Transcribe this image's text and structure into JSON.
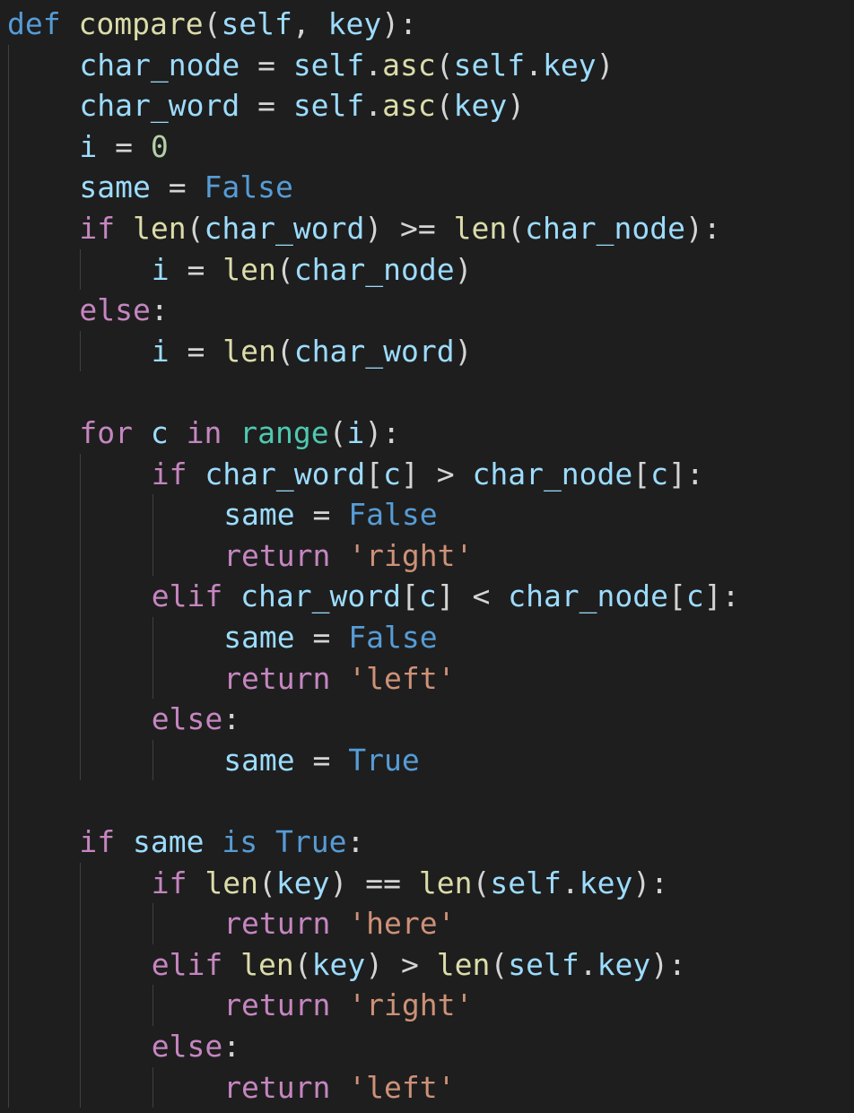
{
  "editor": {
    "language": "python",
    "background": "#1e1e1e",
    "colors": {
      "kw-blue": "#569cd6",
      "kw-ctrl": "#c586c0",
      "fn": "#dcdcaa",
      "cls": "#4ec9b0",
      "var": "#9cdcfe",
      "num": "#b5cea8",
      "str": "#ce9178",
      "op": "#d4d4d4"
    },
    "lines": [
      {
        "indent": 0,
        "tokens": [
          [
            "kw-blue",
            "def"
          ],
          [
            "op",
            " "
          ],
          [
            "fn",
            "compare"
          ],
          [
            "op",
            "("
          ],
          [
            "var",
            "self"
          ],
          [
            "op",
            ", "
          ],
          [
            "var",
            "key"
          ],
          [
            "op",
            "):"
          ]
        ]
      },
      {
        "indent": 1,
        "tokens": [
          [
            "var",
            "char_node"
          ],
          [
            "op",
            " = "
          ],
          [
            "var",
            "self"
          ],
          [
            "op",
            "."
          ],
          [
            "fn",
            "asc"
          ],
          [
            "op",
            "("
          ],
          [
            "var",
            "self"
          ],
          [
            "op",
            "."
          ],
          [
            "var",
            "key"
          ],
          [
            "op",
            ")"
          ]
        ]
      },
      {
        "indent": 1,
        "tokens": [
          [
            "var",
            "char_word"
          ],
          [
            "op",
            " = "
          ],
          [
            "var",
            "self"
          ],
          [
            "op",
            "."
          ],
          [
            "fn",
            "asc"
          ],
          [
            "op",
            "("
          ],
          [
            "var",
            "key"
          ],
          [
            "op",
            ")"
          ]
        ]
      },
      {
        "indent": 1,
        "tokens": [
          [
            "var",
            "i"
          ],
          [
            "op",
            " = "
          ],
          [
            "num",
            "0"
          ]
        ]
      },
      {
        "indent": 1,
        "tokens": [
          [
            "var",
            "same"
          ],
          [
            "op",
            " = "
          ],
          [
            "kw-blue",
            "False"
          ]
        ]
      },
      {
        "indent": 1,
        "tokens": [
          [
            "kw-ctrl",
            "if"
          ],
          [
            "op",
            " "
          ],
          [
            "fn",
            "len"
          ],
          [
            "op",
            "("
          ],
          [
            "var",
            "char_word"
          ],
          [
            "op",
            ") >= "
          ],
          [
            "fn",
            "len"
          ],
          [
            "op",
            "("
          ],
          [
            "var",
            "char_node"
          ],
          [
            "op",
            "):"
          ]
        ]
      },
      {
        "indent": 2,
        "tokens": [
          [
            "var",
            "i"
          ],
          [
            "op",
            " = "
          ],
          [
            "fn",
            "len"
          ],
          [
            "op",
            "("
          ],
          [
            "var",
            "char_node"
          ],
          [
            "op",
            ")"
          ]
        ]
      },
      {
        "indent": 1,
        "tokens": [
          [
            "kw-ctrl",
            "else"
          ],
          [
            "op",
            ":"
          ]
        ]
      },
      {
        "indent": 2,
        "tokens": [
          [
            "var",
            "i"
          ],
          [
            "op",
            " = "
          ],
          [
            "fn",
            "len"
          ],
          [
            "op",
            "("
          ],
          [
            "var",
            "char_word"
          ],
          [
            "op",
            ")"
          ]
        ]
      },
      {
        "indent": 0,
        "tokens": []
      },
      {
        "indent": 1,
        "tokens": [
          [
            "kw-ctrl",
            "for"
          ],
          [
            "op",
            " "
          ],
          [
            "var",
            "c"
          ],
          [
            "op",
            " "
          ],
          [
            "kw-ctrl",
            "in"
          ],
          [
            "op",
            " "
          ],
          [
            "cls",
            "range"
          ],
          [
            "op",
            "("
          ],
          [
            "var",
            "i"
          ],
          [
            "op",
            "):"
          ]
        ]
      },
      {
        "indent": 2,
        "tokens": [
          [
            "kw-ctrl",
            "if"
          ],
          [
            "op",
            " "
          ],
          [
            "var",
            "char_word"
          ],
          [
            "op",
            "["
          ],
          [
            "var",
            "c"
          ],
          [
            "op",
            "] > "
          ],
          [
            "var",
            "char_node"
          ],
          [
            "op",
            "["
          ],
          [
            "var",
            "c"
          ],
          [
            "op",
            "]:"
          ]
        ]
      },
      {
        "indent": 3,
        "tokens": [
          [
            "var",
            "same"
          ],
          [
            "op",
            " = "
          ],
          [
            "kw-blue",
            "False"
          ]
        ]
      },
      {
        "indent": 3,
        "tokens": [
          [
            "kw-ctrl",
            "return"
          ],
          [
            "op",
            " "
          ],
          [
            "str",
            "'right'"
          ]
        ]
      },
      {
        "indent": 2,
        "tokens": [
          [
            "kw-ctrl",
            "elif"
          ],
          [
            "op",
            " "
          ],
          [
            "var",
            "char_word"
          ],
          [
            "op",
            "["
          ],
          [
            "var",
            "c"
          ],
          [
            "op",
            "] < "
          ],
          [
            "var",
            "char_node"
          ],
          [
            "op",
            "["
          ],
          [
            "var",
            "c"
          ],
          [
            "op",
            "]:"
          ]
        ]
      },
      {
        "indent": 3,
        "tokens": [
          [
            "var",
            "same"
          ],
          [
            "op",
            " = "
          ],
          [
            "kw-blue",
            "False"
          ]
        ]
      },
      {
        "indent": 3,
        "tokens": [
          [
            "kw-ctrl",
            "return"
          ],
          [
            "op",
            " "
          ],
          [
            "str",
            "'left'"
          ]
        ]
      },
      {
        "indent": 2,
        "tokens": [
          [
            "kw-ctrl",
            "else"
          ],
          [
            "op",
            ":"
          ]
        ]
      },
      {
        "indent": 3,
        "tokens": [
          [
            "var",
            "same"
          ],
          [
            "op",
            " = "
          ],
          [
            "kw-blue",
            "True"
          ]
        ]
      },
      {
        "indent": 0,
        "tokens": []
      },
      {
        "indent": 1,
        "tokens": [
          [
            "kw-ctrl",
            "if"
          ],
          [
            "op",
            " "
          ],
          [
            "var",
            "same"
          ],
          [
            "op",
            " "
          ],
          [
            "kw-blue",
            "is"
          ],
          [
            "op",
            " "
          ],
          [
            "kw-blue",
            "True"
          ],
          [
            "op",
            ":"
          ]
        ]
      },
      {
        "indent": 2,
        "tokens": [
          [
            "kw-ctrl",
            "if"
          ],
          [
            "op",
            " "
          ],
          [
            "fn",
            "len"
          ],
          [
            "op",
            "("
          ],
          [
            "var",
            "key"
          ],
          [
            "op",
            ") == "
          ],
          [
            "fn",
            "len"
          ],
          [
            "op",
            "("
          ],
          [
            "var",
            "self"
          ],
          [
            "op",
            "."
          ],
          [
            "var",
            "key"
          ],
          [
            "op",
            "):"
          ]
        ]
      },
      {
        "indent": 3,
        "tokens": [
          [
            "kw-ctrl",
            "return"
          ],
          [
            "op",
            " "
          ],
          [
            "str",
            "'here'"
          ]
        ]
      },
      {
        "indent": 2,
        "tokens": [
          [
            "kw-ctrl",
            "elif"
          ],
          [
            "op",
            " "
          ],
          [
            "fn",
            "len"
          ],
          [
            "op",
            "("
          ],
          [
            "var",
            "key"
          ],
          [
            "op",
            ") > "
          ],
          [
            "fn",
            "len"
          ],
          [
            "op",
            "("
          ],
          [
            "var",
            "self"
          ],
          [
            "op",
            "."
          ],
          [
            "var",
            "key"
          ],
          [
            "op",
            "):"
          ]
        ]
      },
      {
        "indent": 3,
        "tokens": [
          [
            "kw-ctrl",
            "return"
          ],
          [
            "op",
            " "
          ],
          [
            "str",
            "'right'"
          ]
        ]
      },
      {
        "indent": 2,
        "tokens": [
          [
            "kw-ctrl",
            "else"
          ],
          [
            "op",
            ":"
          ]
        ]
      },
      {
        "indent": 3,
        "tokens": [
          [
            "kw-ctrl",
            "return"
          ],
          [
            "op",
            " "
          ],
          [
            "str",
            "'left'"
          ]
        ]
      }
    ]
  }
}
